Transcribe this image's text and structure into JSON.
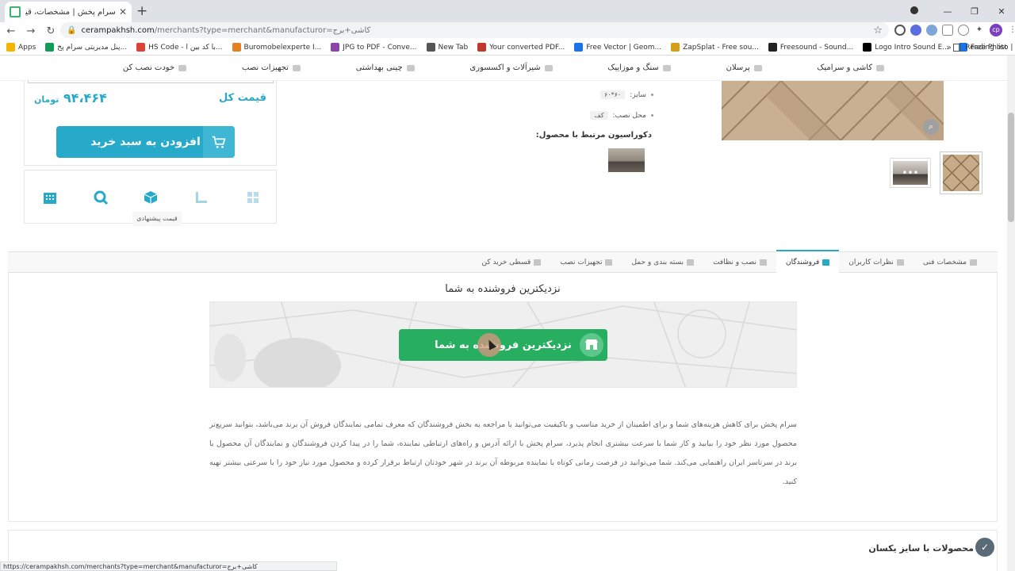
{
  "browser": {
    "tab_title": "سرام پخش | مشخصات، قیمت و خر",
    "url_host": "cerampakhsh.com",
    "url_path": "/merchants?type=merchant&manufacturor=کاشی+برج",
    "bookmarks": [
      {
        "label": "Apps",
        "color": "#f4b400"
      },
      {
        "label": "پنل مدیریتی سرام پخ...",
        "color": "#0f9d58"
      },
      {
        "label": "HS Code - با کد بین ا...",
        "color": "#db4437"
      },
      {
        "label": "Buromobelexperte I...",
        "color": "#e67e22"
      },
      {
        "label": "JPG to PDF - Conve...",
        "color": "#8e44ad"
      },
      {
        "label": "New Tab",
        "color": "#555555"
      },
      {
        "label": "Your converted PDF...",
        "color": "#c0392b"
      },
      {
        "label": "Free Vector | Geom...",
        "color": "#1a73e8"
      },
      {
        "label": "ZapSplat - Free sou...",
        "color": "#d4a017"
      },
      {
        "label": "Freesound - Sound...",
        "color": "#222222"
      },
      {
        "label": "Logo Intro Sound E...",
        "color": "#000000"
      },
      {
        "label": "Free Photo | Minim...",
        "color": "#1a73e8"
      }
    ],
    "reading_list": "Reading list",
    "avatar_initials": "cp",
    "status_url": "https://cerampakhsh.com/merchants?type=merchant&manufacturor=کاشی+برج"
  },
  "site_nav": [
    "کاشی و سرامیک",
    "پرسلان",
    "سنگ و موزاییک",
    "شیرآلات و اکسسوری",
    "چینی بهداشتی",
    "تجهیزات نصب",
    "خودت نصب کن"
  ],
  "price_box": {
    "label": "قیمت کل",
    "value": "۹۴،۴۶۴",
    "currency": "تومان",
    "add_to_cart": "افزودن به سبد خرید",
    "tooltip": "قیمت پیشنهادی"
  },
  "product": {
    "size_label": "سایز:",
    "size_value": "۶۰*۶۰",
    "place_label": "محل نصب:",
    "place_value": "کف",
    "deco_title": "دکوراسیون مرتبط با محصول:"
  },
  "tabs": [
    {
      "label": "مشخصات فنی",
      "active": false
    },
    {
      "label": "نظرات کاربران",
      "active": false
    },
    {
      "label": "فروشندگان",
      "active": true
    },
    {
      "label": "نصب و نظافت",
      "active": false
    },
    {
      "label": "بسته بندی و حمل",
      "active": false
    },
    {
      "label": "تجهیزات نصب",
      "active": false
    },
    {
      "label": "قسطی خرید کن",
      "active": false
    }
  ],
  "merchants": {
    "title": "نزدیکترین فروشنده به شما",
    "button": "نزدیکترین فروشنده به شما",
    "description": "سرام پخش برای کاهش هزینه‌های شما و برای اطمینان از خرید مناسب و باکیفیت می‌توانید با مراجعه به بخش فروشندگان که معرف تمامی نمایندگان فروش آن برند می‌باشد، بتوانید سریع‌تر محصول مورد نظر خود را بیابید و کار شما با سرعت بیشتری انجام پذیرد، سرام پخش با ارائه آدرس و راه‌های ارتباطی نماینده، شما را در پیدا کردن فروشندگان و نمایندگان آن محصول یا برند در سرتاسر ایران راهنمایی می‌کند. شما می‌توانید در فرصت زمانی کوتاه با نماینده مربوطه آن برند در شهر خودتان ارتباط برقرار کرده و محصول مورد نیاز خود را با سرعتی بیشتر تهیه کنید."
  },
  "same_size": {
    "title": "محصولات با سایز یکسان"
  },
  "colors": {
    "accent": "#27a9c9",
    "green": "#27ae60"
  }
}
